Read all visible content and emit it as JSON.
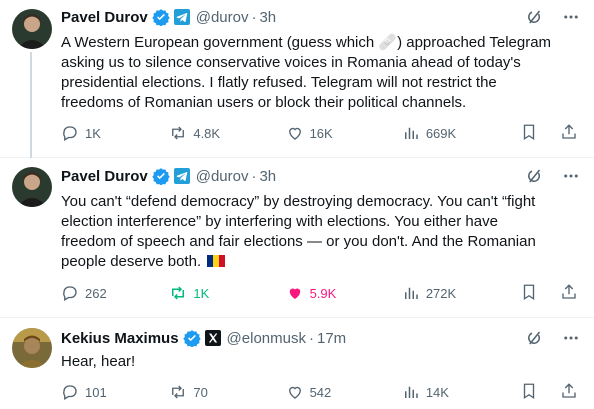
{
  "tweets": [
    {
      "name": "Pavel Durov",
      "handle": "@durov",
      "separator": "·",
      "time": "3h",
      "text_lines": [
        "A Western European government (guess which 🩹) approached Telegram",
        "asking us to silence conservative voices in Romania ahead of today's",
        "presidential elections. I flatly refused. Telegram will not restrict the",
        "freedoms of Romanian users or block their political channels."
      ],
      "replies": "1K",
      "reposts": "4.8K",
      "likes": "16K",
      "views": "669K",
      "liked": false,
      "reposted": false
    },
    {
      "name": "Pavel Durov",
      "handle": "@durov",
      "separator": "·",
      "time": "3h",
      "text_lines": [
        "You can't “defend democracy” by destroying democracy. You can't “fight",
        "election interference” by interfering with elections. You either have",
        "freedom of speech and fair elections — or you don't. And the Romanian",
        "people deserve both."
      ],
      "replies": "262",
      "reposts": "1K",
      "likes": "5.9K",
      "views": "272K",
      "liked": true,
      "reposted": true
    },
    {
      "name": "Kekius Maximus",
      "handle": "@elonmusk",
      "separator": "·",
      "time": "17m",
      "text_lines": [
        "Hear, hear!"
      ],
      "replies": "101",
      "reposts": "70",
      "likes": "542",
      "views": "14K",
      "liked": false,
      "reposted": false
    }
  ],
  "colors": {
    "verified": "#1d9bf0",
    "muted": "#536471",
    "repost_active": "#00ba7c",
    "like_active": "#f91880",
    "telegram_badge": "#229ed9"
  },
  "icons": [
    "verified-badge-icon",
    "telegram-affiliate-icon",
    "x-affiliate-icon",
    "grok-icon",
    "more-icon",
    "reply-icon",
    "repost-icon",
    "like-icon",
    "views-icon",
    "bookmark-icon",
    "share-icon",
    "romania-flag-icon"
  ]
}
